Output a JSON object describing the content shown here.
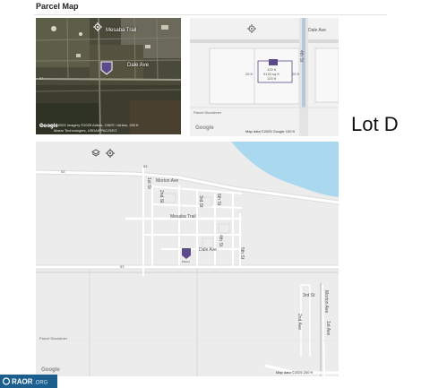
{
  "section": {
    "title": "Parcel Map"
  },
  "satellite_map": {
    "streets": [
      "Mesaba Trail",
      "Dale Ave"
    ],
    "road_shield": "53",
    "attribution_line1": "Map data ©2025 Imagery ©2025 Airbus, CNES / Airbus, 200 ft",
    "attribution_line2": "Maxar Technologies, USDA/FPAC/GEO",
    "brand": "Google",
    "icons": [
      "layers-icon",
      "locate-icon"
    ],
    "accent": "#5b4b8a"
  },
  "parcel_tile": {
    "street_top": "Dale Ave",
    "street_side": "4th St",
    "dimension_lines": [
      "125 ft",
      "9120 sq ft",
      "125 ft"
    ],
    "side_dims": [
      "25 ft",
      "25 ft"
    ],
    "disclaimer": "Parcel Disclaimer",
    "attribution": "Map data ©2025 Google   100 ft",
    "brand": "Google"
  },
  "lot_label": "Lot D",
  "overview_map": {
    "streets": [
      "Morton Ave",
      "Mesaba Trail",
      "Dale Ave",
      "2nd St",
      "3rd St",
      "4th St",
      "5th St",
      "1st St",
      "6th St",
      "3rd St",
      "2nd Ave",
      "1st Ave",
      "Morton Ave"
    ],
    "road_shields": [
      "53",
      "53",
      "53"
    ],
    "pin_caption": "Parcel",
    "disclaimer": "Parcel Disclaimer",
    "attribution": "Map data ©2025  200 ft",
    "brand": "Google",
    "water_color": "#a9d8ef"
  },
  "watermark": {
    "text": "RAOR.ORG"
  }
}
